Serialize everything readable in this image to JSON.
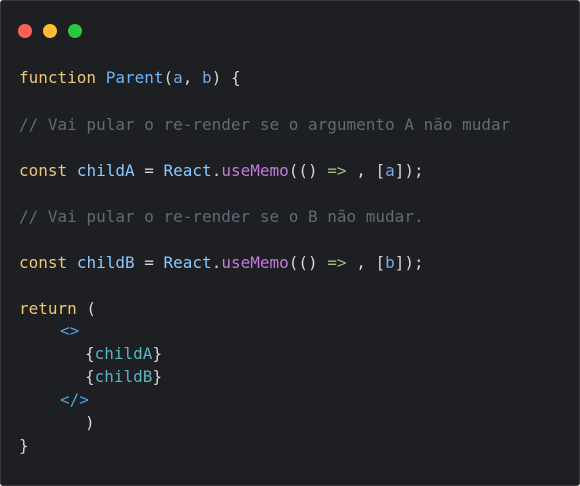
{
  "window": {
    "controls": [
      "close",
      "minimize",
      "maximize"
    ],
    "colors": {
      "close": "#ff5f57",
      "minimize": "#febc2e",
      "maximize": "#28c840",
      "background": "#1e1f22"
    }
  },
  "code": {
    "l1": {
      "kw": "function",
      "name": "Parent",
      "open": "(",
      "a": "a",
      "comma": ", ",
      "b": "b",
      "close": ") {"
    },
    "l2": {
      "comment": "// Vai pular o re-render se o argumento A não mudar"
    },
    "l3": {
      "kw": "const",
      "var": "childA",
      "eq": " = ",
      "obj": "React",
      "dot": ".",
      "method": "useMemo",
      "open": "(() ",
      "arrow": "=>",
      "rest1": " , [",
      "arg": "a",
      "rest2": "]);"
    },
    "l4": {
      "comment": "// Vai pular o re-render se o B não mudar."
    },
    "l5": {
      "kw": "const",
      "var": "childB",
      "eq": " = ",
      "obj": "React",
      "dot": ".",
      "method": "useMemo",
      "open": "(() ",
      "arrow": "=>",
      "rest1": " , [",
      "arg": "b",
      "rest2": "]);"
    },
    "l6": {
      "kw": "return",
      "rest": " ("
    },
    "l7": {
      "tag": "<>"
    },
    "l8": {
      "open": "{",
      "expr": "childA",
      "close": "}"
    },
    "l9": {
      "open": "{",
      "expr": "childB",
      "close": "}"
    },
    "l10": {
      "tag": "</>"
    },
    "l11": {
      "text": ")"
    },
    "l12": {
      "text": "}"
    }
  }
}
